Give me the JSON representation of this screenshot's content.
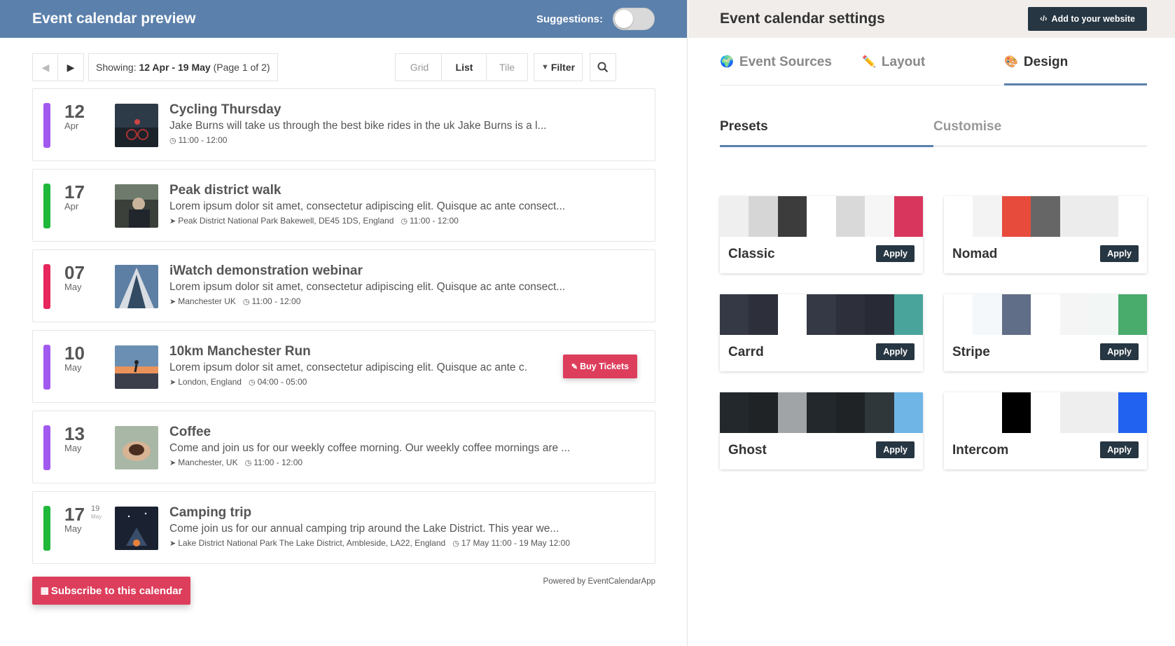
{
  "preview": {
    "title": "Event calendar preview",
    "suggestions_label": "Suggestions:",
    "showing_prefix": "Showing:",
    "showing_range": "12 Apr - 19 May",
    "showing_page": "(Page 1 of 2)",
    "views": [
      "Grid",
      "List",
      "Tile"
    ],
    "filter_label": "Filter",
    "subscribe_label": "Subscribe to this calendar",
    "powered_by": "Powered by EventCalendarApp",
    "events": [
      {
        "day": "12",
        "month": "Apr",
        "color": "#a259f0",
        "title": "Cycling Thursday",
        "desc": "Jake Burns will take us through the best bike rides in the uk Jake Burns is a l...",
        "location": "",
        "time": "11:00 - 12:00"
      },
      {
        "day": "17",
        "month": "Apr",
        "color": "#1fb83a",
        "title": "Peak district walk",
        "desc": "Lorem ipsum dolor sit amet, consectetur adipiscing elit. Quisque ac ante consect...",
        "location": "Peak District National Park Bakewell, DE45 1DS, England",
        "time": "11:00 - 12:00"
      },
      {
        "day": "07",
        "month": "May",
        "color": "#e6265c",
        "title": "iWatch demonstration webinar",
        "desc": "Lorem ipsum dolor sit amet, consectetur adipiscing elit. Quisque ac ante consect...",
        "location": "Manchester UK",
        "time": "11:00 - 12:00"
      },
      {
        "day": "10",
        "month": "May",
        "color": "#a259f0",
        "title": "10km Manchester Run",
        "desc": "Lorem ipsum dolor sit amet, consectetur adipiscing elit. Quisque ac ante c...",
        "location": "London, England",
        "time": "04:00 - 05:00",
        "buy_label": "Buy Tickets"
      },
      {
        "day": "13",
        "month": "May",
        "color": "#a259f0",
        "title": "Coffee",
        "desc": "Come and join us for our weekly coffee morning. Our weekly coffee mornings are ...",
        "location": "Manchester, UK",
        "time": "11:00 - 12:00"
      },
      {
        "day": "17",
        "month": "May",
        "end_day": "19",
        "end_month": "May",
        "color": "#1fb83a",
        "title": "Camping trip",
        "desc": "Come join us for our annual camping trip around the Lake District. This year we...",
        "location": "Lake District National Park The Lake District, Ambleside, LA22, England",
        "time": "17 May 11:00 - 19 May 12:00"
      }
    ]
  },
  "settings": {
    "title": "Event calendar settings",
    "add_button": "Add to your website",
    "tabs": [
      "Event Sources",
      "Layout",
      "Design"
    ],
    "subtabs": [
      "Presets",
      "Customise"
    ],
    "apply_label": "Apply",
    "presets": [
      {
        "name": "Classic",
        "colors": [
          "#efefef",
          "#d6d6d6",
          "#3c3c3c",
          "#ffffff",
          "#d9d9d9",
          "#f6f6f6",
          "#d9365d"
        ]
      },
      {
        "name": "Nomad",
        "colors": [
          "#ffffff",
          "#f3f3f3",
          "#e64b3c",
          "#666666",
          "#ececec",
          "#ececec",
          "#ffffff"
        ]
      },
      {
        "name": "Carrd",
        "colors": [
          "#353845",
          "#2d303b",
          "#ffffff",
          "#353845",
          "#2d303b",
          "#282b35",
          "#49a49b"
        ]
      },
      {
        "name": "Stripe",
        "colors": [
          "#ffffff",
          "#f5f8fb",
          "#616e87",
          "#ffffff",
          "#f5f5f5",
          "#f2f7f5",
          "#49ab6c"
        ]
      },
      {
        "name": "Ghost",
        "colors": [
          "#23282c",
          "#1f2326",
          "#a1a4a6",
          "#23282c",
          "#1f2326",
          "#30373b",
          "#6fb5e6"
        ]
      },
      {
        "name": "Intercom",
        "colors": [
          "#ffffff",
          "#ffffff",
          "#000000",
          "#ffffff",
          "#eeeeee",
          "#eeeeee",
          "#2163f0"
        ]
      }
    ]
  }
}
